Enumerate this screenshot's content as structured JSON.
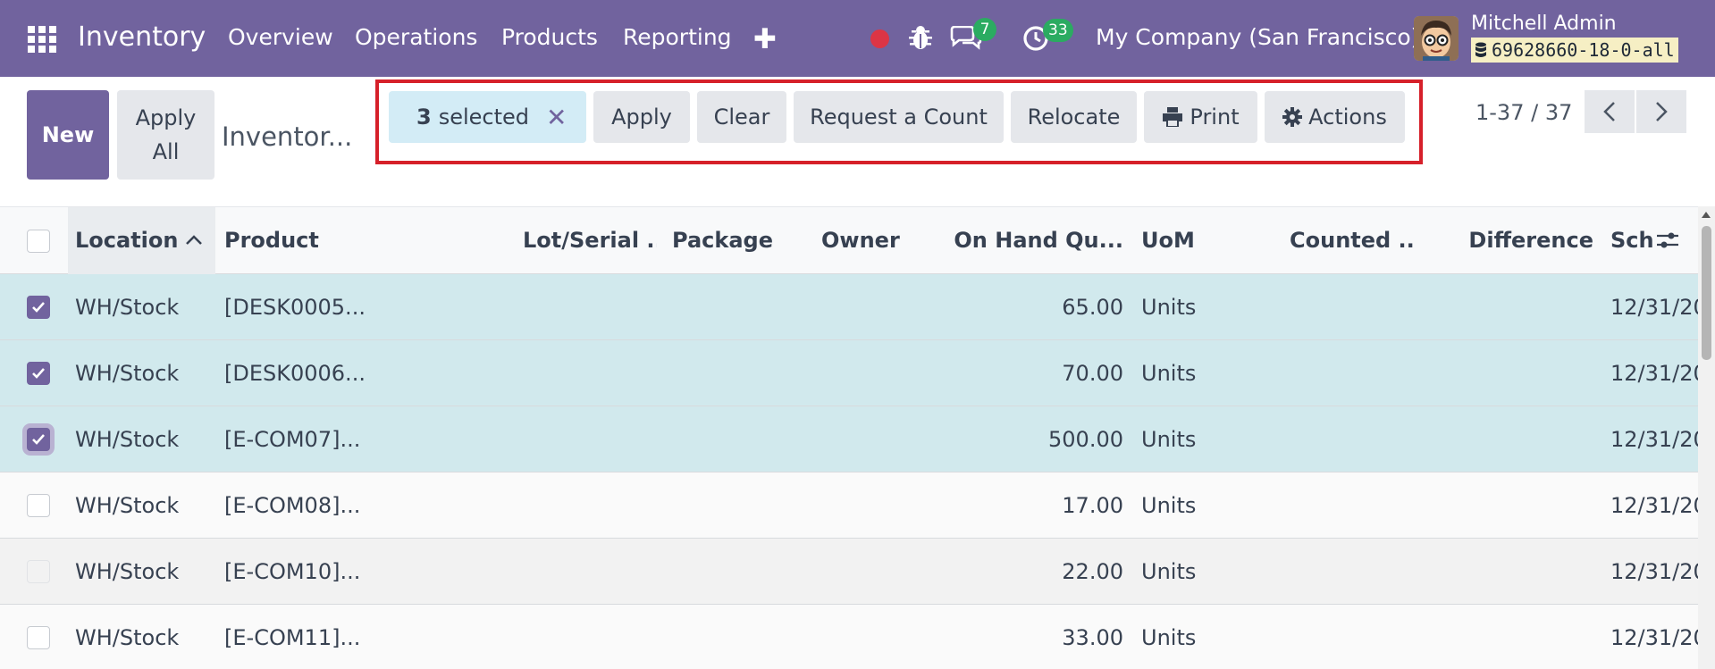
{
  "navbar": {
    "brand": "Inventory",
    "menu": [
      "Overview",
      "Operations",
      "Products",
      "Reporting"
    ],
    "messages_badge": "7",
    "activities_badge": "33",
    "company": "My Company (San Francisco)",
    "user_name": "Mitchell Admin",
    "database": "69628660-18-0-all",
    "colors": {
      "navbar": "#71639e",
      "badge": "#2bab61",
      "record_dot": "#dc3545"
    }
  },
  "control_panel": {
    "new_label": "New",
    "apply_all_line1": "Apply",
    "apply_all_line2": "All",
    "breadcrumb": "Inventor...",
    "selection": {
      "count": "3",
      "text": "selected"
    },
    "actions": {
      "apply": "Apply",
      "clear": "Clear",
      "request_count": "Request a Count",
      "relocate": "Relocate",
      "print": "Print",
      "actions": "Actions"
    },
    "pager": "1-37 / 37"
  },
  "table": {
    "columns": {
      "location": "Location",
      "product": "Product",
      "lot": "Lot/Serial ...",
      "package": "Package",
      "owner": "Owner",
      "on_hand": "On Hand Qu...",
      "uom": "UoM",
      "counted": "Counted ...",
      "difference": "Difference",
      "scheduled": "Sch"
    },
    "rows": [
      {
        "location": "WH/Stock",
        "product": "[DESK0005...",
        "on_hand": "65.00",
        "uom": "Units",
        "scheduled": "12/31/20",
        "checked": true
      },
      {
        "location": "WH/Stock",
        "product": "[DESK0006...",
        "on_hand": "70.00",
        "uom": "Units",
        "scheduled": "12/31/20",
        "checked": true
      },
      {
        "location": "WH/Stock",
        "product": "[E-COM07]...",
        "on_hand": "500.00",
        "uom": "Units",
        "scheduled": "12/31/20",
        "checked": true
      },
      {
        "location": "WH/Stock",
        "product": "[E-COM08]...",
        "on_hand": "17.00",
        "uom": "Units",
        "scheduled": "12/31/20",
        "checked": false
      },
      {
        "location": "WH/Stock",
        "product": "[E-COM10]...",
        "on_hand": "22.00",
        "uom": "Units",
        "scheduled": "12/31/20",
        "checked": false
      },
      {
        "location": "WH/Stock",
        "product": "[E-COM11]...",
        "on_hand": "33.00",
        "uom": "Units",
        "scheduled": "12/31/20",
        "checked": false
      }
    ]
  },
  "icons": {
    "apps": "apps-grid-icon",
    "plus": "plus-icon",
    "record": "record-icon",
    "bug": "bug-icon",
    "chat": "chat-icon",
    "clock": "activity-clock-icon",
    "database": "database-icon",
    "close": "close-icon",
    "print": "printer-icon",
    "actions": "gear-icon",
    "sort": "sort-ascending-icon",
    "settings": "column-settings-icon"
  }
}
